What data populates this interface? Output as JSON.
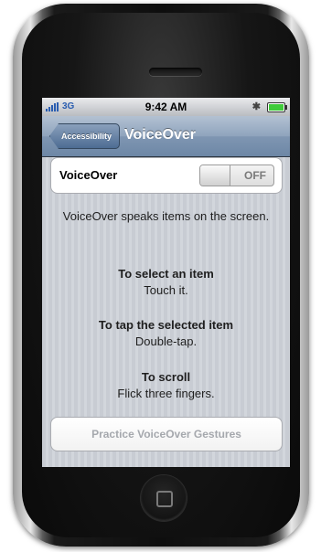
{
  "status_bar": {
    "carrier": "3G",
    "time": "9:42 AM",
    "bluetooth_icon": "bluetooth-icon",
    "battery_level": 1.0
  },
  "nav": {
    "back_label": "Accessibility",
    "title": "VoiceOver"
  },
  "voiceover_cell": {
    "label": "VoiceOver",
    "toggle_state": "OFF"
  },
  "description": "VoiceOver speaks items on the screen.",
  "instructions": [
    {
      "heading": "To select an item",
      "detail": "Touch it."
    },
    {
      "heading": "To tap the selected item",
      "detail": "Double-tap."
    },
    {
      "heading": "To scroll",
      "detail": "Flick three fingers."
    }
  ],
  "practice_button": "Practice VoiceOver Gestures",
  "colors": {
    "nav_bar": "#7f96b2",
    "signal": "#2a5db0",
    "battery": "#3fcb3a",
    "disabled_text": "#a5a8ad"
  },
  "icons": {
    "signal": "signal-bars-icon",
    "home": "home-button-icon"
  }
}
